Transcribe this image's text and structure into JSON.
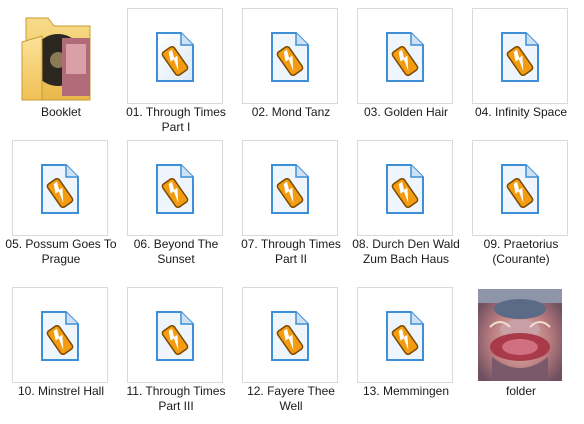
{
  "items": [
    {
      "name": "Booklet",
      "type": "folder"
    },
    {
      "name": "01. Through Times Part I",
      "type": "audio"
    },
    {
      "name": "02. Mond Tanz",
      "type": "audio"
    },
    {
      "name": "03. Golden Hair",
      "type": "audio"
    },
    {
      "name": "04. Infinity Space",
      "type": "audio"
    },
    {
      "name": "05. Possum Goes To Prague",
      "type": "audio"
    },
    {
      "name": "06. Beyond The Sunset",
      "type": "audio"
    },
    {
      "name": "07. Through Times Part II",
      "type": "audio"
    },
    {
      "name": "08. Durch Den Wald Zum Bach Haus",
      "type": "audio"
    },
    {
      "name": "09. Praetorius (Courante)",
      "type": "audio"
    },
    {
      "name": "10. Minstrel Hall",
      "type": "audio"
    },
    {
      "name": "11. Through Times Part III",
      "type": "audio"
    },
    {
      "name": "12. Fayere Thee Well",
      "type": "audio"
    },
    {
      "name": "13. Memmingen",
      "type": "audio"
    },
    {
      "name": "folder",
      "type": "image"
    }
  ],
  "icons": {
    "folder": "folder-icon",
    "audio": "winamp-audio-file-icon",
    "image": "album-cover-image-thumbnail"
  },
  "colors": {
    "folder": "#f4c95d",
    "file_blue": "#3e8fd6",
    "lightning": "#f39c12"
  }
}
